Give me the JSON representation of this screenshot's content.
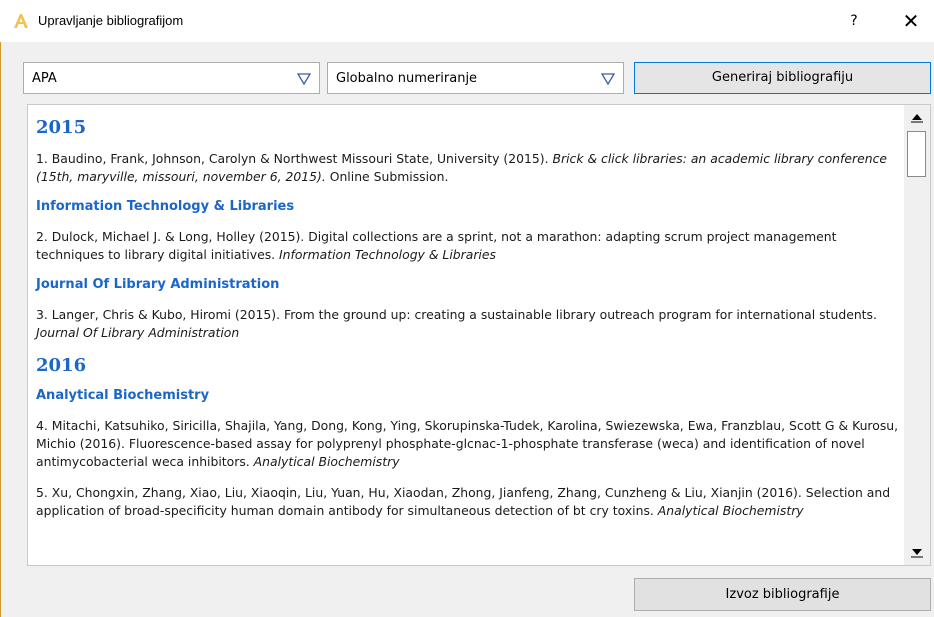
{
  "window": {
    "title": "Upravljanje bibliografijom",
    "help_label": "?",
    "close_label": "✕"
  },
  "toolbar": {
    "style_value": "APA",
    "numbering_value": "Globalno numeriranje",
    "generate_label": "Generiraj bibliografiju"
  },
  "bibliography": {
    "sections": [
      {
        "year": "2015"
      },
      {
        "year": "2016"
      }
    ],
    "journals": [
      "Information Technology & Libraries",
      "Journal Of Library Administration",
      "Analytical Biochemistry"
    ],
    "entries": [
      {
        "text": "1. Baudino, Frank, Johnson, Carolyn & Northwest Missouri State, University (2015). ",
        "italic": "Brick & click libraries: an academic library conference (15th, maryville, missouri, november 6, 2015).",
        "tail": " Online Submission."
      },
      {
        "text": "2. Dulock, Michael J. & Long, Holley (2015). Digital collections are a sprint, not a marathon: adapting scrum project management techniques to library digital initiatives. ",
        "italic": "Information Technology & Libraries",
        "tail": ""
      },
      {
        "text": "3. Langer, Chris & Kubo, Hiromi (2015). From the ground up: creating a sustainable library outreach program for international students. ",
        "italic": "Journal Of Library Administration",
        "tail": ""
      },
      {
        "text": "4. Mitachi, Katsuhiko, Siricilla, Shajila, Yang, Dong, Kong, Ying, Skorupinska-Tudek, Karolina, Swiezewska, Ewa, Franzblau, Scott G & Kurosu, Michio (2016). Fluorescence-based assay for polyprenyl phosphate-glcnac-1-phosphate transferase (weca) and identification of novel antimycobacterial weca inhibitors. ",
        "italic": "Analytical Biochemistry",
        "tail": ""
      },
      {
        "text": "5. Xu, Chongxin, Zhang, Xiao, Liu, Xiaoqin, Liu, Yuan, Hu, Xiaodan, Zhong, Jianfeng, Zhang, Cunzheng & Liu, Xianjin (2016). Selection and application of broad-specificity human domain antibody for simultaneous detection of bt cry toxins. ",
        "italic": "Analytical Biochemistry",
        "tail": ""
      }
    ]
  },
  "footer": {
    "export_label": "Izvoz bibliografije"
  },
  "colors": {
    "accent": "#1b66c9",
    "focus_border": "#0078d7"
  }
}
